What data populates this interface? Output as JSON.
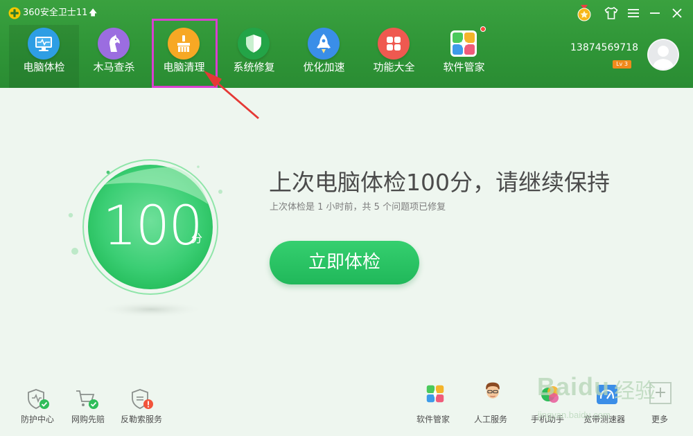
{
  "app": {
    "title": "360安全卫士11",
    "upgrade_icon": "up-arrow-icon"
  },
  "window_controls": {
    "medal_icon": "medal-icon",
    "skin_icon": "shirt-icon",
    "menu_icon": "menu-icon",
    "minimize_icon": "minimize-icon",
    "close_icon": "close-icon"
  },
  "nav": [
    {
      "label": "电脑体检",
      "icon": "monitor-icon",
      "color": "#2e9ee4"
    },
    {
      "label": "木马查杀",
      "icon": "horse-icon",
      "color": "#9b6de0"
    },
    {
      "label": "电脑清理",
      "icon": "broom-icon",
      "color": "#f7a824"
    },
    {
      "label": "系统修复",
      "icon": "shield-icon",
      "color": "#23a447"
    },
    {
      "label": "优化加速",
      "icon": "rocket-icon",
      "color": "#3a8ee8"
    },
    {
      "label": "功能大全",
      "icon": "grid-icon",
      "color": "#ef5950"
    },
    {
      "label": "软件管家",
      "icon": "software-manager-icon",
      "color": "#f05b7a"
    }
  ],
  "account": {
    "phone": "13874569718",
    "level": "Lv 3",
    "avatar_icon": "user-avatar-icon"
  },
  "status": {
    "score": "100",
    "unit": "分",
    "headline": "上次电脑体检100分，请继续保持",
    "detail": "上次体检是 1 小时前，共 5 个问题项已修复",
    "button_label": "立即体检"
  },
  "bottom_left": [
    {
      "label": "防护中心",
      "icon": "shield-check-icon"
    },
    {
      "label": "网购先赔",
      "icon": "shopping-cart-icon"
    },
    {
      "label": "反勒索服务",
      "icon": "shield-alert-icon"
    }
  ],
  "bottom_right": [
    {
      "label": "软件管家",
      "icon": "software-manager-icon"
    },
    {
      "label": "人工服务",
      "icon": "support-agent-icon"
    },
    {
      "label": "手机助手",
      "icon": "phone-assistant-icon"
    },
    {
      "label": "宽带测速器",
      "icon": "speedtest-icon"
    },
    {
      "label": "更多",
      "icon": "plus-icon"
    }
  ],
  "watermark": {
    "text": "Baidu",
    "cn": "经验",
    "sub": "jingyan.baidu.com"
  },
  "colors": {
    "header_green": "#2f9537",
    "scan_button": "#27c464",
    "highlight": "#d93fd1",
    "arrow": "#e53935"
  }
}
